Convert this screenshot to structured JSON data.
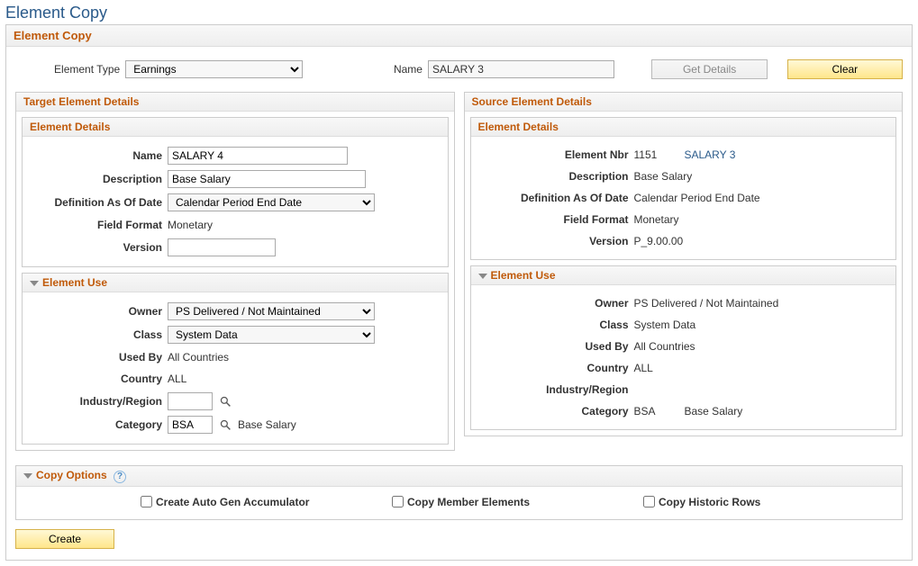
{
  "page_title": "Element Copy",
  "panel_title": "Element Copy",
  "top": {
    "element_type_label": "Element Type",
    "element_type_value": "Earnings",
    "name_label": "Name",
    "name_value": "SALARY 3",
    "get_details_label": "Get Details",
    "clear_label": "Clear"
  },
  "target": {
    "header": "Target Element Details",
    "details_header": "Element Details",
    "name_label": "Name",
    "name_value": "SALARY 4",
    "description_label": "Description",
    "description_value": "Base Salary",
    "defasof_label": "Definition As Of Date",
    "defasof_value": "Calendar Period End Date",
    "field_format_label": "Field Format",
    "field_format_value": "Monetary",
    "version_label": "Version",
    "version_value": "",
    "use_header": "Element Use",
    "owner_label": "Owner",
    "owner_value": "PS Delivered / Not Maintained",
    "class_label": "Class",
    "class_value": "System Data",
    "usedby_label": "Used By",
    "usedby_value": "All Countries",
    "country_label": "Country",
    "country_value": "ALL",
    "industry_label": "Industry/Region",
    "industry_value": "",
    "category_label": "Category",
    "category_value": "BSA",
    "category_desc": "Base Salary"
  },
  "source": {
    "header": "Source Element Details",
    "details_header": "Element Details",
    "element_nbr_label": "Element Nbr",
    "element_nbr_value": "1151",
    "element_link": "SALARY 3",
    "description_label": "Description",
    "description_value": "Base Salary",
    "defasof_label": "Definition As Of Date",
    "defasof_value": "Calendar Period End Date",
    "field_format_label": "Field Format",
    "field_format_value": "Monetary",
    "version_label": "Version",
    "version_value": "P_9.00.00",
    "use_header": "Element Use",
    "owner_label": "Owner",
    "owner_value": "PS Delivered / Not Maintained",
    "class_label": "Class",
    "class_value": "System Data",
    "usedby_label": "Used By",
    "usedby_value": "All Countries",
    "country_label": "Country",
    "country_value": "ALL",
    "industry_label": "Industry/Region",
    "industry_value": "",
    "category_label": "Category",
    "category_value": "BSA",
    "category_desc": "Base Salary"
  },
  "copy_options": {
    "header": "Copy Options",
    "auto_gen_label": "Create Auto Gen Accumulator",
    "copy_members_label": "Copy Member Elements",
    "copy_historic_label": "Copy Historic Rows"
  },
  "create_label": "Create"
}
